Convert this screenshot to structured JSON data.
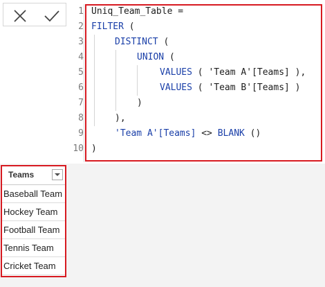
{
  "formula_bar": {
    "cancel_icon": "x-icon",
    "commit_icon": "checkmark-icon",
    "line_numbers": [
      "1",
      "2",
      "3",
      "4",
      "5",
      "6",
      "7",
      "8",
      "9",
      "10"
    ],
    "code": {
      "l1": "Uniq_Team_Table =",
      "l2_kw": "FILTER",
      "l2_rest": " (",
      "l3_kw": "DISTINCT",
      "l3_rest": " (",
      "l4_kw": "UNION",
      "l4_rest": " (",
      "l5_kw": "VALUES",
      "l5_p1": " ( ",
      "l5_str": "'Team A'[Teams]",
      "l5_p2": " ),",
      "l6_kw": "VALUES",
      "l6_p1": " ( ",
      "l6_str": "'Team B'[Teams]",
      "l6_p2": " )",
      "l7": ")",
      "l8": "),",
      "l9_str": "'Team A'[Teams]",
      "l9_op": " <> ",
      "l9_kw": "BLANK",
      "l9_rest": " ()",
      "l10": ")"
    }
  },
  "table": {
    "column_header": "Teams",
    "rows": [
      "Baseball Team",
      "Hockey Team",
      "Football Team",
      "Tennis Team",
      "Cricket Team"
    ]
  },
  "colors": {
    "highlight": "#d71920",
    "keyword": "#1a3fa8",
    "string": "#a31515"
  }
}
